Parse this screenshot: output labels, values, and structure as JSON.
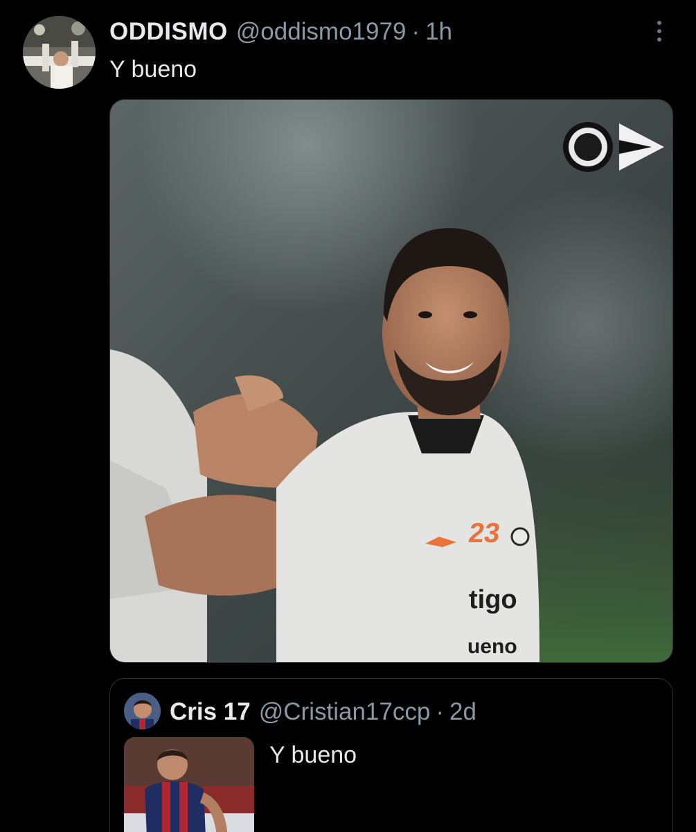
{
  "tweet": {
    "display_name": "ODDISMO",
    "handle": "@oddismo1979",
    "separator": "·",
    "time": "1h",
    "text": "Y bueno",
    "media": {
      "jersey_number": "23",
      "sponsor_top": "tigo",
      "sponsor_bottom": "ueno"
    }
  },
  "quote": {
    "display_name": "Cris 17",
    "handle": "@Cristian17ccp",
    "separator": "·",
    "time": "2d",
    "text": "Y bueno"
  },
  "colors": {
    "background": "#000000",
    "primary_text": "#e7e9ea",
    "secondary_text": "#8b98a5",
    "border": "#2f3336"
  },
  "icons": {
    "more": "vertical-ellipsis-icon",
    "club_crest": "club-crest-icon",
    "brand_logo": "arrow-flag-logo-icon"
  }
}
